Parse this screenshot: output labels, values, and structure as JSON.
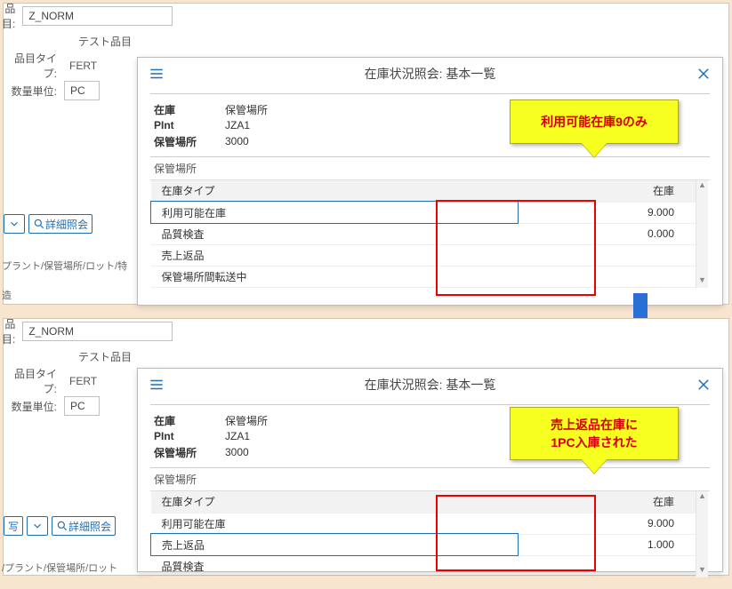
{
  "form": {
    "item_label": "品目:",
    "item_value": "Z_NORM",
    "test_item_label": "テスト品目",
    "item_type_label": "品目タイプ:",
    "item_type_value": "FERT",
    "qty_unit_label": "数量単位:",
    "qty_unit_value": "PC",
    "detail_button": "詳細照会",
    "breadcrumb_top": "プラント/保管場所/ロット/特",
    "breadcrumb_bottom": "/プラント/保管場所/ロット",
    "resume": "造",
    "squiggle": "写"
  },
  "dialog": {
    "title": "在庫状況照会: 基本一覧",
    "info": {
      "stock_label": "在庫",
      "stock_value": "保管場所",
      "plnt_label": "PInt",
      "plnt_value": "JZA1",
      "storage_loc_label": "保管場所",
      "storage_loc_value": "3000"
    },
    "section": "保管場所",
    "col_type": "在庫タイプ",
    "col_stock": "在庫"
  },
  "top_table": [
    {
      "label": "利用可能在庫",
      "value": "9.000",
      "selected": true
    },
    {
      "label": "品質検査",
      "value": "0.000"
    },
    {
      "label": "売上返品",
      "value": ""
    },
    {
      "label": "保管場所間転送中",
      "value": ""
    }
  ],
  "bottom_table": [
    {
      "label": "利用可能在庫",
      "value": "9.000"
    },
    {
      "label": "売上返品",
      "value": "1.000",
      "selected": true
    },
    {
      "label": "品質検査",
      "value": ""
    }
  ],
  "callouts": {
    "top": "利用可能在庫9のみ",
    "bottom": "売上返品在庫に\n1PC入庫された"
  }
}
